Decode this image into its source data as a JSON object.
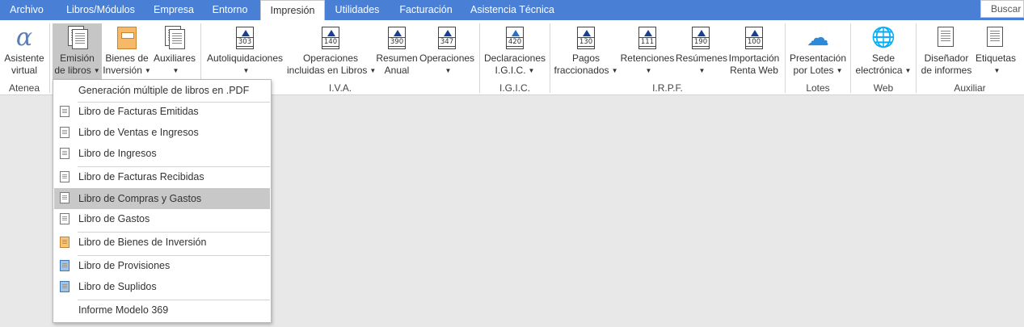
{
  "tabs": [
    {
      "label": "Archivo",
      "active": false
    },
    {
      "label": "Libros/Módulos",
      "active": false
    },
    {
      "label": "Empresa",
      "active": false
    },
    {
      "label": "Entorno",
      "active": false
    },
    {
      "label": "Impresión",
      "active": true
    },
    {
      "label": "Utilidades",
      "active": false
    },
    {
      "label": "Facturación",
      "active": false
    },
    {
      "label": "Asistencia Técnica",
      "active": false
    }
  ],
  "search": {
    "label": "Buscar"
  },
  "ribbon": {
    "groups": {
      "atenea": "Atenea",
      "iva": "I.V.A.",
      "igic": "I.G.I.C.",
      "irpf": "I.R.P.F.",
      "lotes": "Lotes",
      "web": "Web",
      "auxiliar": "Auxiliar"
    },
    "buttons": {
      "asistente_1": "Asistente",
      "asistente_2": "virtual",
      "emision_1": "Emisión",
      "emision_2": "de libros",
      "bienes_1": "Bienes de",
      "bienes_2": "Inversión",
      "auxiliares_1": "Auxiliares",
      "autoliq_1": "Autoliquidaciones",
      "opinc_1": "Operaciones",
      "opinc_2": "incluidas en Libros",
      "resumen_1": "Resumen",
      "resumen_2": "Anual",
      "operaciones_1": "Operaciones",
      "declar_1": "Declaraciones",
      "declar_2": "I.G.I.C.",
      "pagos_1": "Pagos",
      "pagos_2": "fraccionados",
      "retenciones_1": "Retenciones",
      "resumenes_1": "Resúmenes",
      "importacion_1": "Importación",
      "importacion_2": "Renta Web",
      "presentacion_1": "Presentación",
      "presentacion_2": "por Lotes",
      "sede_1": "Sede",
      "sede_2": "electrónica",
      "disenador_1": "Diseñador",
      "disenador_2": "de informes",
      "etiquetas_1": "Etiquetas"
    },
    "form_numbers": {
      "autoliq": "303",
      "opinc": "140",
      "resumen": "390",
      "operaciones": "347",
      "declar": "420",
      "pagos": "130",
      "retenciones": "111",
      "resumenes": "190",
      "importacion": "100"
    }
  },
  "menu": {
    "items": [
      {
        "label": "Generación múltiple de libros en .PDF",
        "icon": "none"
      },
      {
        "label": "Libro de Facturas Emitidas",
        "icon": "book-icon"
      },
      {
        "label": "Libro de Ventas e Ingresos",
        "icon": "book-icon"
      },
      {
        "label": "Libro de Ingresos",
        "icon": "book-icon"
      },
      {
        "label": "Libro de Facturas Recibidas",
        "icon": "book-icon"
      },
      {
        "label": "Libro de Compras y Gastos",
        "icon": "book-icon",
        "highlighted": true
      },
      {
        "label": "Libro de Gastos",
        "icon": "book-icon"
      },
      {
        "label": "Libro de Bienes de Inversión",
        "icon": "orange-book-icon"
      },
      {
        "label": "Libro de Provisiones",
        "icon": "blue-book-icon"
      },
      {
        "label": "Libro de Suplidos",
        "icon": "blue-book-icon"
      },
      {
        "label": "Informe Modelo 369",
        "icon": "none"
      }
    ]
  },
  "colors": {
    "tabbar": "#4a7fd6",
    "highlight": "#c8c8c8",
    "background": "#e8e8e8"
  }
}
